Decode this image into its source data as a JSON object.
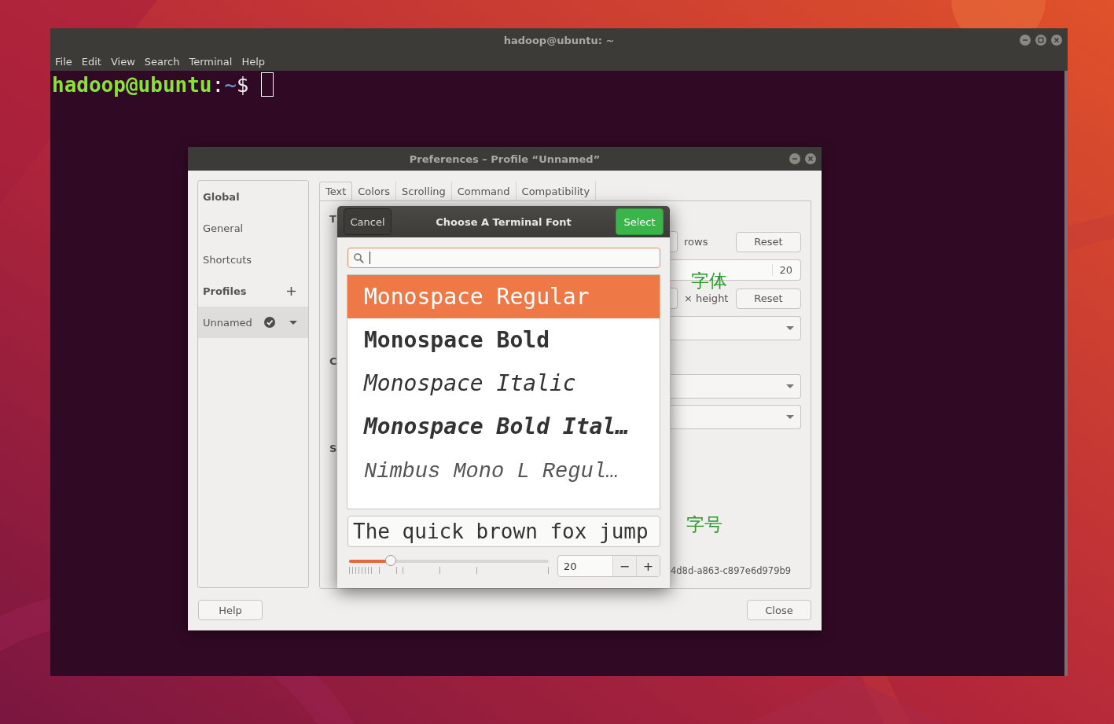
{
  "terminal": {
    "title": "hadoop@ubuntu: ~",
    "menu": [
      "File",
      "Edit",
      "View",
      "Search",
      "Terminal",
      "Help"
    ],
    "prompt": {
      "user_host": "hadoop@ubuntu",
      "separator": ":",
      "path": "~",
      "symbol": "$"
    }
  },
  "preferences": {
    "title": "Preferences – Profile “Unnamed”",
    "sidebar": [
      {
        "kind": "heading",
        "label": "Global"
      },
      {
        "kind": "item",
        "label": "General",
        "selected": false
      },
      {
        "kind": "item",
        "label": "Shortcuts",
        "selected": false
      },
      {
        "kind": "heading-add",
        "label": "Profiles"
      },
      {
        "kind": "profile",
        "label": "Unnamed",
        "selected": true
      }
    ],
    "tabs": [
      {
        "label": "Text",
        "selected": true
      },
      {
        "label": "Colors",
        "selected": false
      },
      {
        "label": "Scrolling",
        "selected": false
      },
      {
        "label": "Command",
        "selected": false
      },
      {
        "label": "Compatibility",
        "selected": false
      }
    ],
    "section_initials": [
      "T",
      "C",
      "S"
    ],
    "size_row": {
      "unit": "rows",
      "button": "Reset"
    },
    "font_field": {
      "value": "20"
    },
    "spacing_row": {
      "unit": "× height",
      "button": "Reset"
    },
    "id_fragment": "4d8d-a863-c897e6d979b9",
    "annotations": [
      "字体",
      "字号"
    ],
    "buttons": {
      "help": "Help",
      "close": "Close"
    }
  },
  "font_dialog": {
    "title": "Choose A Terminal Font",
    "cancel": "Cancel",
    "select": "Select",
    "fonts": [
      {
        "name": "Monospace Regular",
        "kind": "regular",
        "selected": true
      },
      {
        "name": "Monospace Bold",
        "kind": "bold",
        "selected": false
      },
      {
        "name": "Monospace Italic",
        "kind": "italic",
        "selected": false
      },
      {
        "name": "Monospace Bold Ital…",
        "kind": "bolditalic",
        "selected": false
      },
      {
        "name": "Nimbus Mono L Regul…",
        "kind": "nimbus",
        "selected": false
      }
    ],
    "preview": "The quick brown fox jump",
    "size": {
      "level": 0.21,
      "value": "20",
      "decrement": "−",
      "increment": "+"
    }
  }
}
